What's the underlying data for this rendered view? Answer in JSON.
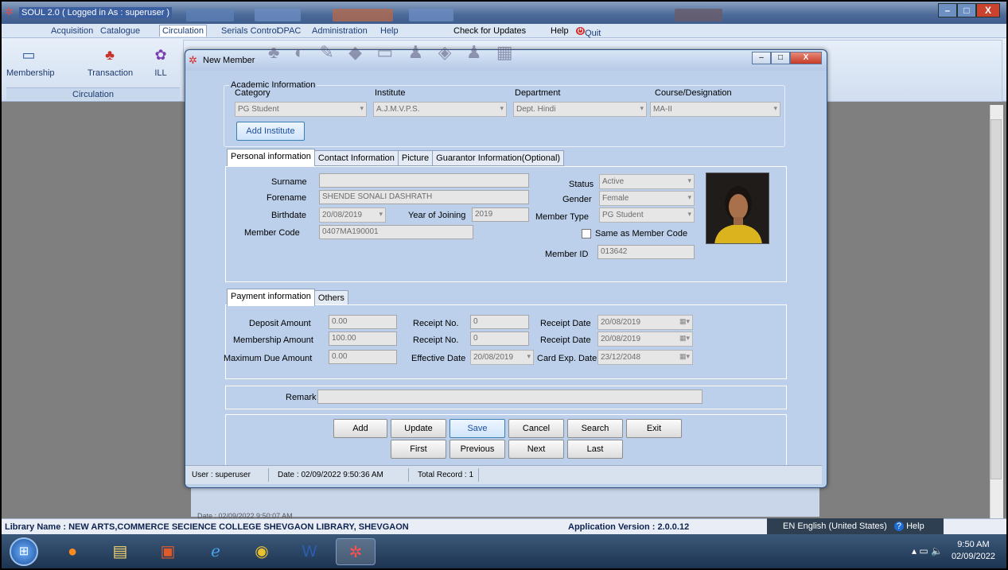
{
  "app": {
    "title": "SOUL 2.0  ( Logged in As : superuser )",
    "window_controls": [
      "–",
      "□",
      "X"
    ]
  },
  "menubar": {
    "items": [
      "Acquisition",
      "Catalogue",
      "Circulation",
      "Serials Control",
      "OPAC",
      "Administration",
      "Help"
    ],
    "selected": "Circulation",
    "right_items": [
      "Check for Updates",
      "Help",
      "Quit"
    ]
  },
  "ribbon": {
    "buttons": [
      "Membership",
      "Transaction",
      "ILL"
    ],
    "group_label": "Circulation"
  },
  "dialog": {
    "title": "New Member",
    "academic": {
      "legend": "Academic Information",
      "category_label": "Category",
      "institute_label": "Institute",
      "department_label": "Department",
      "course_label": "Course/Designation",
      "category_value": "PG Student",
      "institute_value": "A.J.M.V.P.S.",
      "department_value": "Dept. Hindi",
      "course_value": "MA-II",
      "add_institute": "Add Institute"
    },
    "personal_tabs": [
      "Personal information",
      "Contact Information",
      "Picture",
      "Guarantor Information(Optional)"
    ],
    "personal": {
      "surname_label": "Surname",
      "surname_value": "",
      "forename_label": "Forename",
      "forename_value": "SHENDE SONALI DASHRATH",
      "birthdate_label": "Birthdate",
      "birthdate_value": "20/08/2019",
      "yoj_label": "Year of Joining",
      "yoj_value": "2019",
      "member_code_label": "Member Code",
      "member_code_value": "0407MA190001",
      "status_label": "Status",
      "status_value": "Active",
      "gender_label": "Gender",
      "gender_value": "Female",
      "member_type_label": "Member Type",
      "member_type_value": "PG Student",
      "same_as_label": "Same as Member Code",
      "member_id_label": "Member ID",
      "member_id_value": "013642"
    },
    "payment_tabs": [
      "Payment information",
      "Others"
    ],
    "payment": {
      "deposit_label": "Deposit Amount",
      "deposit_value": "0.00",
      "membership_label": "Membership Amount",
      "membership_value": "100.00",
      "maxdue_label": "Maximum Due Amount",
      "maxdue_value": "0.00",
      "receipt_no_label": "Receipt No.",
      "receipt_no_1": "0",
      "receipt_no_2": "0",
      "effective_label": "Effective Date",
      "effective_value": "20/08/2019",
      "receipt_date_label": "Receipt Date",
      "receipt_date_1": "20/08/2019",
      "receipt_date_2": "20/08/2019",
      "card_exp_label": "Card Exp. Date",
      "card_exp_value": "23/12/2048"
    },
    "remark_label": "Remark",
    "remark_value": "",
    "buttons_row1": [
      "Add",
      "Update",
      "Save",
      "Cancel",
      "Search",
      "Exit"
    ],
    "buttons_row2": [
      "First",
      "Previous",
      "Next",
      "Last"
    ],
    "status": {
      "user": "User : superuser",
      "date": "Date : 02/09/2022 9:50:36 AM",
      "total": "Total Record : 1"
    }
  },
  "background_status": "Date : 02/09/2022 9:50:07 AM",
  "footer": {
    "library_name": "Library Name : NEW ARTS,COMMERCE  SECIENCE COLLEGE SHEVGAON LIBRARY, SHEVGAON",
    "app_version": "Application Version : 2.0.0.12",
    "language": "EN English (United States)",
    "help": "Help"
  },
  "taskbar": {
    "time": "9:50 AM",
    "date": "02/09/2022"
  }
}
